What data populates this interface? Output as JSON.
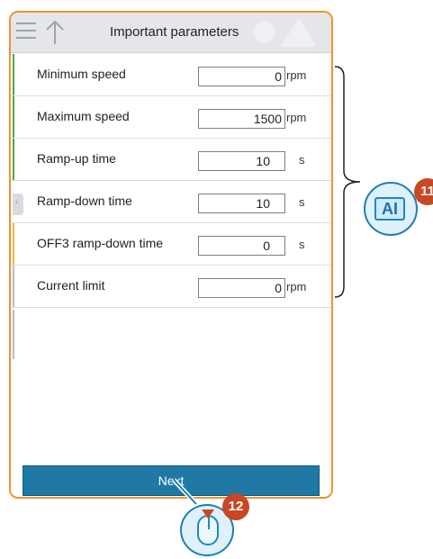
{
  "header": {
    "title": "Important parameters"
  },
  "rows": [
    {
      "label": "Minimum speed",
      "value": "0",
      "unit": "rpm",
      "bar": "#4aa84a"
    },
    {
      "label": "Maximum speed",
      "value": "1500",
      "unit": "rpm",
      "bar": "#4aa84a"
    },
    {
      "label": "Ramp-up time",
      "value": "10",
      "unit": "s",
      "bar": "#4aa84a"
    },
    {
      "label": "Ramp-down time",
      "value": "10",
      "unit": "s",
      "bar": ""
    },
    {
      "label": "OFF3 ramp-down time",
      "value": "0",
      "unit": "s",
      "bar": "#f0b84a"
    },
    {
      "label": "Current limit",
      "value": "0",
      "unit": "rpm",
      "bar": "#b7bec5"
    }
  ],
  "footer": {
    "next_label": "Next"
  },
  "callouts": {
    "ai_label": "AI",
    "badge_ai": "11",
    "badge_mouse": "12"
  },
  "colors": {
    "panel_border": "#f0932f",
    "button": "#1f79a4",
    "callout_blue": "#1f7fb0",
    "badge": "#c84724"
  }
}
